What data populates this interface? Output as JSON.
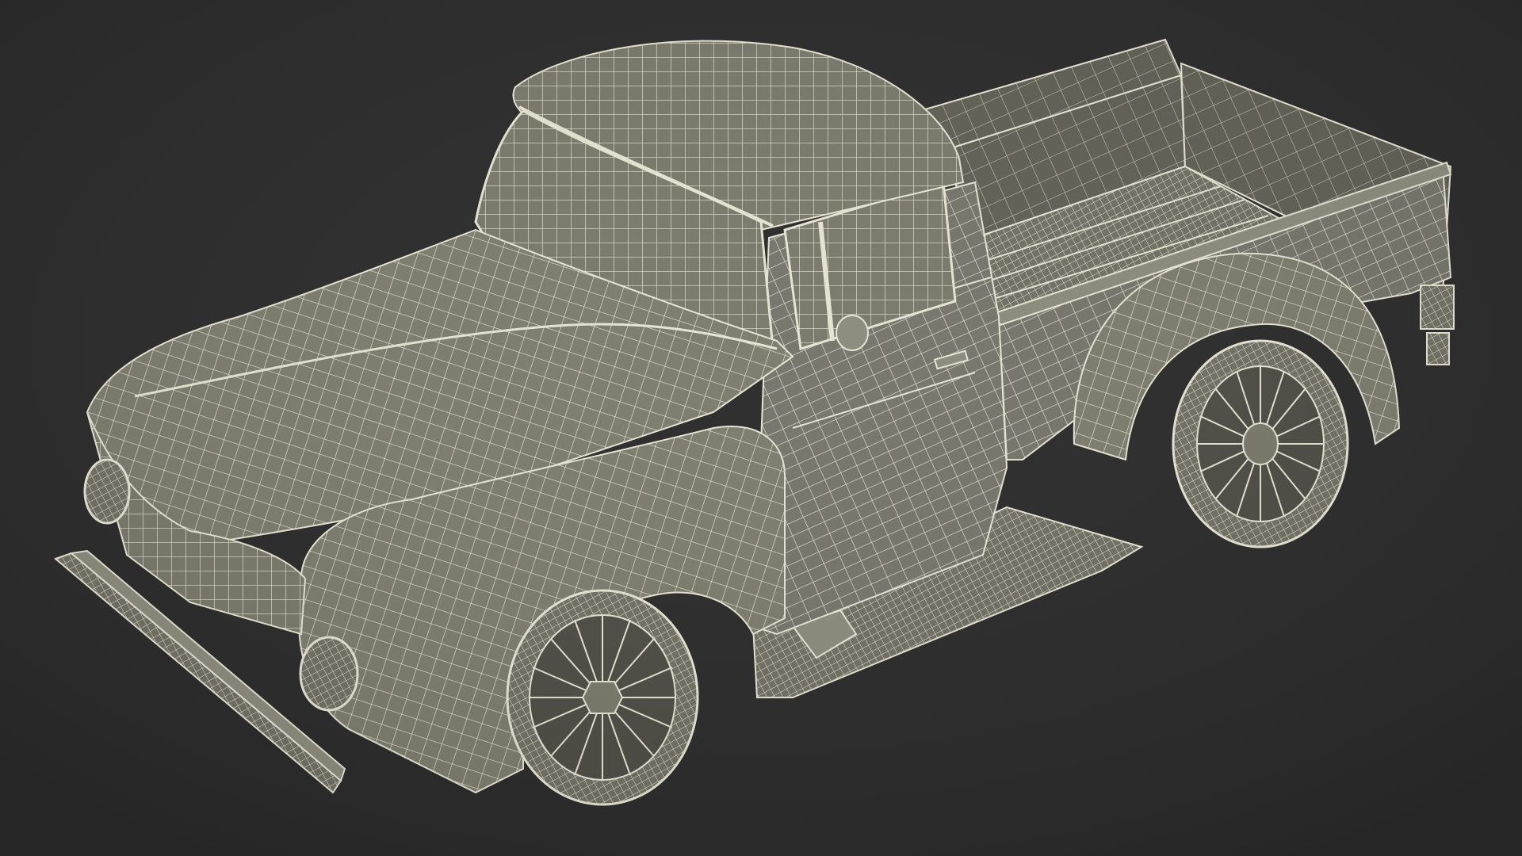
{
  "scene": {
    "subject": "",
    "background_color": "#2a2a2a",
    "mesh_fill": "#78786a",
    "mesh_fill_dark": "#5f5f54",
    "wire_color": "#e6e3d2"
  }
}
